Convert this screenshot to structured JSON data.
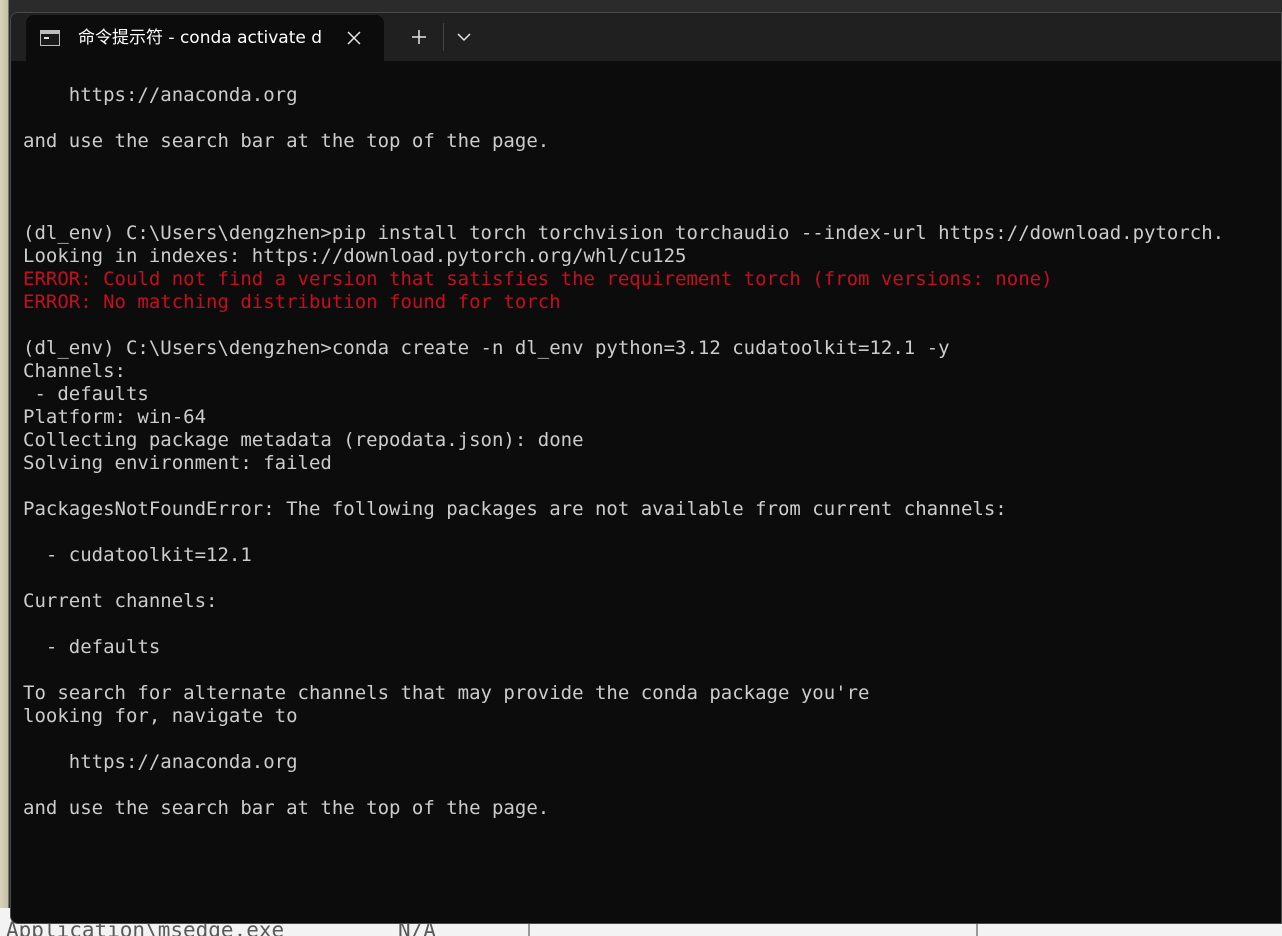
{
  "window": {
    "tab_title": "命令提示符 - conda  activate d",
    "tab_icon": "terminal-icon",
    "close_icon": "close-icon",
    "new_tab_icon": "plus-icon",
    "dropdown_icon": "chevron-down-icon"
  },
  "colors": {
    "background": "#0c0c0c",
    "text": "#cccccc",
    "error": "#c50f1f",
    "titlebar": "#202020"
  },
  "terminal": {
    "lines": [
      {
        "text": "",
        "style": "normal"
      },
      {
        "text": "    https://anaconda.org",
        "style": "normal"
      },
      {
        "text": "",
        "style": "normal"
      },
      {
        "text": "and use the search bar at the top of the page.",
        "style": "normal"
      },
      {
        "text": "",
        "style": "normal"
      },
      {
        "text": "",
        "style": "normal"
      },
      {
        "text": "",
        "style": "normal"
      },
      {
        "text": "(dl_env) C:\\Users\\dengzhen>pip install torch torchvision torchaudio --index-url https://download.pytorch.",
        "style": "normal"
      },
      {
        "text": "Looking in indexes: https://download.pytorch.org/whl/cu125",
        "style": "normal"
      },
      {
        "text": "ERROR: Could not find a version that satisfies the requirement torch (from versions: none)",
        "style": "error"
      },
      {
        "text": "ERROR: No matching distribution found for torch",
        "style": "error"
      },
      {
        "text": "",
        "style": "normal"
      },
      {
        "text": "(dl_env) C:\\Users\\dengzhen>conda create -n dl_env python=3.12 cudatoolkit=12.1 -y",
        "style": "normal"
      },
      {
        "text": "Channels:",
        "style": "normal"
      },
      {
        "text": " - defaults",
        "style": "normal"
      },
      {
        "text": "Platform: win-64",
        "style": "normal"
      },
      {
        "text": "Collecting package metadata (repodata.json): done",
        "style": "normal"
      },
      {
        "text": "Solving environment: failed",
        "style": "normal"
      },
      {
        "text": "",
        "style": "normal"
      },
      {
        "text": "PackagesNotFoundError: The following packages are not available from current channels:",
        "style": "normal"
      },
      {
        "text": "",
        "style": "normal"
      },
      {
        "text": "  - cudatoolkit=12.1",
        "style": "normal"
      },
      {
        "text": "",
        "style": "normal"
      },
      {
        "text": "Current channels:",
        "style": "normal"
      },
      {
        "text": "",
        "style": "normal"
      },
      {
        "text": "  - defaults",
        "style": "normal"
      },
      {
        "text": "",
        "style": "normal"
      },
      {
        "text": "To search for alternate channels that may provide the conda package you're",
        "style": "normal"
      },
      {
        "text": "looking for, navigate to",
        "style": "normal"
      },
      {
        "text": "",
        "style": "normal"
      },
      {
        "text": "    https://anaconda.org",
        "style": "normal"
      },
      {
        "text": "",
        "style": "normal"
      },
      {
        "text": "and use the search bar at the top of the page.",
        "style": "normal"
      }
    ]
  },
  "background_app": {
    "text_left": "Application\\msedge.exe",
    "text_right": "N/A"
  }
}
